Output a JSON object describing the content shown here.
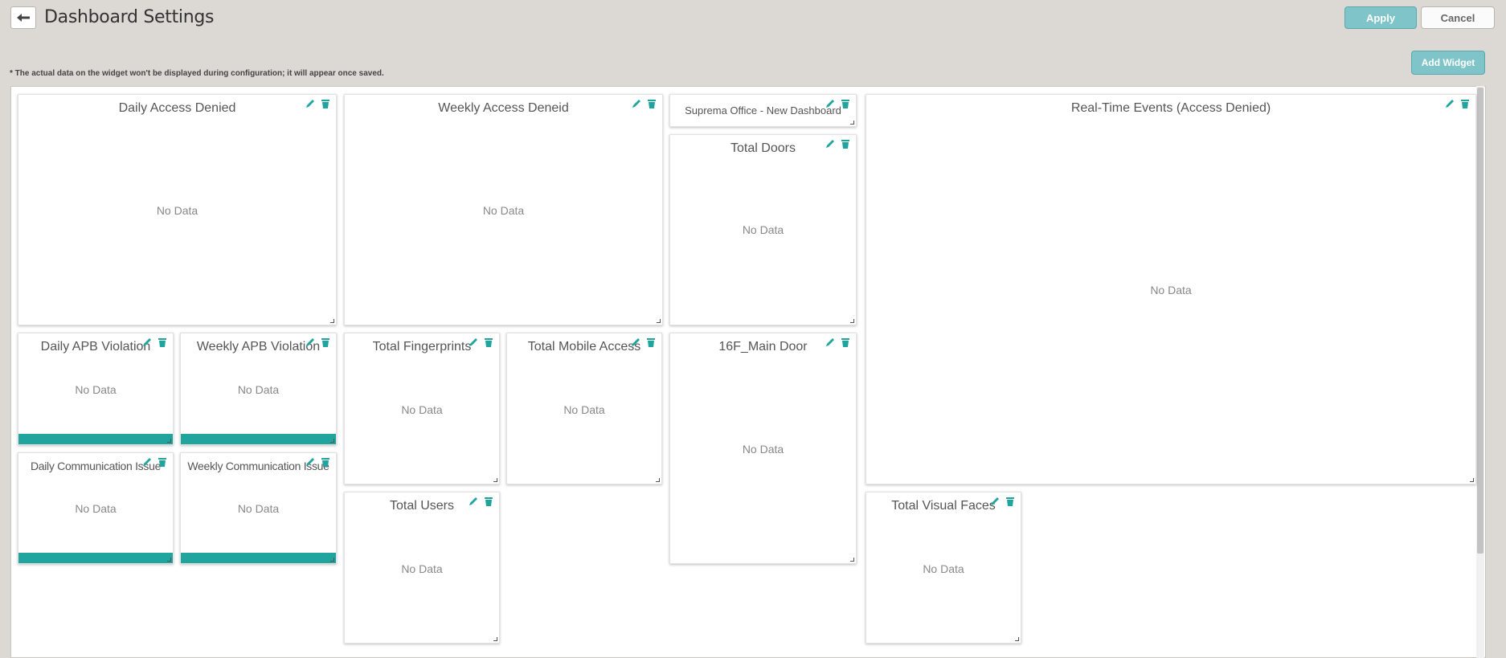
{
  "header": {
    "title": "Dashboard Settings",
    "apply_label": "Apply",
    "cancel_label": "Cancel",
    "add_widget_label": "Add Widget",
    "note": "* The actual data on the widget won't be displayed during configuration; it will appear once saved."
  },
  "colors": {
    "accent": "#1fa59e",
    "button_teal": "#7fc4c8",
    "background": "#dcd8d4"
  },
  "widgets": {
    "daily_access_denied": {
      "title": "Daily Access Denied",
      "body": "No Data"
    },
    "weekly_access_deneid": {
      "title": "Weekly Access Deneid",
      "body": "No Data"
    },
    "suprema_office": {
      "title": "Suprema Office - New Dashboard"
    },
    "total_doors": {
      "title": "Total Doors",
      "body": "No Data"
    },
    "realtime_events": {
      "title": "Real-Time Events (Access Denied)",
      "body": "No Data"
    },
    "daily_apb": {
      "title": "Daily APB Violation",
      "body": "No Data"
    },
    "weekly_apb": {
      "title": "Weekly APB Violation",
      "body": "No Data"
    },
    "total_fingerprints": {
      "title": "Total Fingerprints",
      "body": "No Data"
    },
    "total_mobile_access": {
      "title": "Total Mobile Access",
      "body": "No Data"
    },
    "main_door": {
      "title": "16F_Main Door",
      "body": "No Data"
    },
    "daily_comm": {
      "title": "Daily Communication Issue",
      "body": "No Data"
    },
    "weekly_comm": {
      "title": "Weekly Communication Issue",
      "body": "No Data"
    },
    "total_users": {
      "title": "Total Users",
      "body": "No Data"
    },
    "total_visual_faces": {
      "title": "Total Visual Faces",
      "body": "No Data"
    }
  }
}
